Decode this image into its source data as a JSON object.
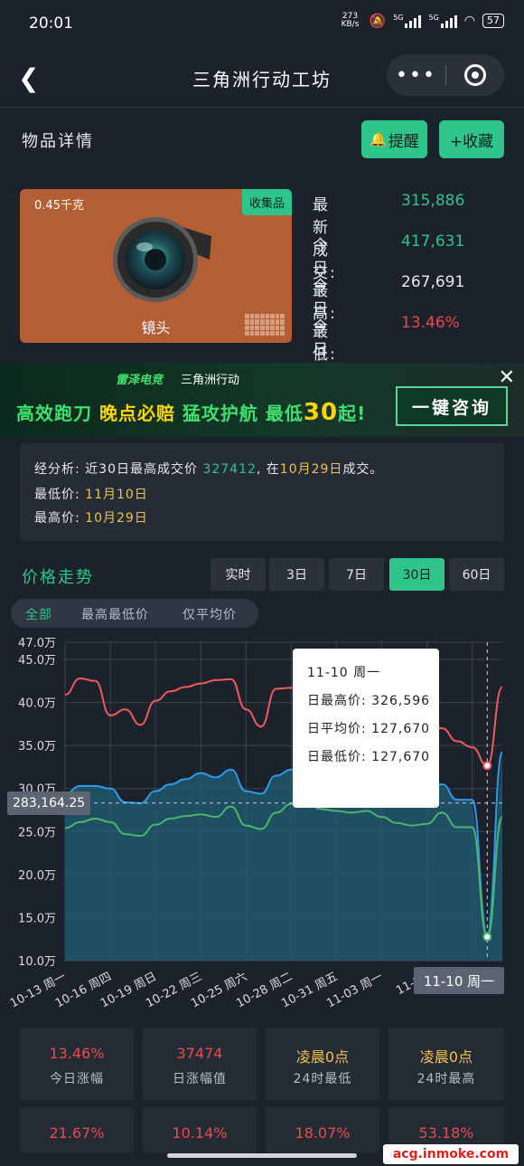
{
  "status": {
    "time": "20:01",
    "net": "273 KB/s",
    "signal1": "5G",
    "signal2": "5G",
    "battery": "57"
  },
  "header": {
    "title": "三角洲行动工坊"
  },
  "section": {
    "title": "物品详情",
    "remind": "提醒",
    "collect": "+收藏"
  },
  "item": {
    "weight": "0.45千克",
    "tag": "收集品",
    "name": "镜头"
  },
  "stats": [
    {
      "label": "最新成交:",
      "value": "315,886",
      "color": "#2fc48a"
    },
    {
      "label": "今日最高:",
      "value": "417,631",
      "color": "#2fc48a"
    },
    {
      "label": "今日最低:",
      "value": "267,691",
      "color": "#e6e9ee"
    },
    {
      "label": "今日涨幅:",
      "value": "13.46%",
      "color": "#e94b4b"
    }
  ],
  "banner": {
    "brand1": "雷泽电竞",
    "brand2": "三角洲行动",
    "headline_a": "高效跑刀",
    "headline_b": "晚点必赔",
    "headline_c": "猛攻护航",
    "headline_d": "最低",
    "headline_num": "30",
    "headline_e": "起!",
    "cta": "一键咨询"
  },
  "analysis": {
    "line1_a": "经分析: 近30日最高成交价 ",
    "line1_price": "327412",
    "line1_b": ", 在",
    "line1_date": "10月29日",
    "line1_c": "成交。",
    "line2_label": "最低价: ",
    "line2_date": "11月10日",
    "line3_label": "最高价: ",
    "line3_date": "10月29日"
  },
  "trend": {
    "title": "价格走势",
    "timeframes": [
      "实时",
      "3日",
      "7日",
      "30日",
      "60日"
    ],
    "active_timeframe": "30日",
    "segments": [
      "全部",
      "最高最低价",
      "仅平均价"
    ],
    "active_segment": "全部"
  },
  "tooltip": {
    "date": "11-10 周一",
    "high": "日最高价: 326,596",
    "avg": "日平均价: 127,670",
    "low": "日最低价: 127,670"
  },
  "crosshair": {
    "y_label": "283,164.25",
    "x_label": "11-10 周一"
  },
  "colors": {
    "accent": "#2fc48a",
    "up": "#e94b4b",
    "gold": "#f2c14e",
    "high_line": "#f05a5a",
    "avg_line": "#2c9bf0",
    "low_line": "#47b86a"
  },
  "chart_data": {
    "type": "line",
    "x": [
      "10-13",
      "10-14",
      "10-15",
      "10-16",
      "10-17",
      "10-18",
      "10-19",
      "10-20",
      "10-21",
      "10-22",
      "10-23",
      "10-24",
      "10-25",
      "10-26",
      "10-27",
      "10-28",
      "10-29",
      "10-30",
      "10-31",
      "11-01",
      "11-02",
      "11-03",
      "11-04",
      "11-05",
      "11-06",
      "11-07",
      "11-08",
      "11-09",
      "11-10",
      "11-11"
    ],
    "tick_labels": [
      "10-13 周一",
      "10-16 周四",
      "10-19 周日",
      "10-22 周三",
      "10-25 周六",
      "10-28 周二",
      "10-31 周五",
      "11-03 周一",
      "11-06",
      ""
    ],
    "yticks": [
      "47.0万",
      "45.0万",
      "40.0万",
      "35.0万",
      "30.0万",
      "25.0万",
      "20.0万",
      "15.0万",
      "10.0万"
    ],
    "ylim": [
      100000,
      470000
    ],
    "series": [
      {
        "values": [
          409000,
          428000,
          425000,
          385000,
          392000,
          374000,
          402000,
          413000,
          418000,
          422000,
          426000,
          427000,
          392000,
          372000,
          416000,
          417000,
          418000,
          420000,
          420000,
          410000,
          415000,
          418000,
          380000,
          377000,
          380000,
          370000,
          355000,
          348000,
          326596,
          418000
        ]
      },
      {
        "values": [
          294000,
          303000,
          303000,
          300000,
          284000,
          283000,
          297000,
          305000,
          311000,
          318000,
          313000,
          322000,
          297000,
          294000,
          315000,
          322000,
          320000,
          310000,
          305000,
          300000,
          302000,
          300000,
          297000,
          295000,
          296000,
          305000,
          287000,
          287000,
          127670,
          342000
        ]
      },
      {
        "values": [
          254000,
          261000,
          265000,
          261000,
          247000,
          245000,
          258000,
          265000,
          268000,
          270000,
          267000,
          279000,
          257000,
          253000,
          272000,
          282000,
          285000,
          276000,
          274000,
          272000,
          274000,
          267000,
          260000,
          257000,
          259000,
          272000,
          255000,
          255000,
          127670,
          267000
        ]
      }
    ],
    "crosshair_y": 283164.25,
    "grid": true
  },
  "summary": [
    {
      "value": "13.46%",
      "label": "今日涨幅",
      "color": "#e94b4b"
    },
    {
      "value": "37474",
      "label": "日涨幅值",
      "color": "#e94b4b"
    },
    {
      "value": "凌晨0点",
      "label": "24时最低",
      "color": "#f2c14e"
    },
    {
      "value": "凌晨0点",
      "label": "24时最高",
      "color": "#f2c14e"
    },
    {
      "value": "21.67%",
      "label": "",
      "color": "#e94b4b"
    },
    {
      "value": "10.14%",
      "label": "",
      "color": "#e94b4b"
    },
    {
      "value": "18.07%",
      "label": "",
      "color": "#e94b4b"
    },
    {
      "value": "53.18%",
      "label": "",
      "color": "#e94b4b"
    }
  ],
  "watermark": "acg.inmoke.com"
}
